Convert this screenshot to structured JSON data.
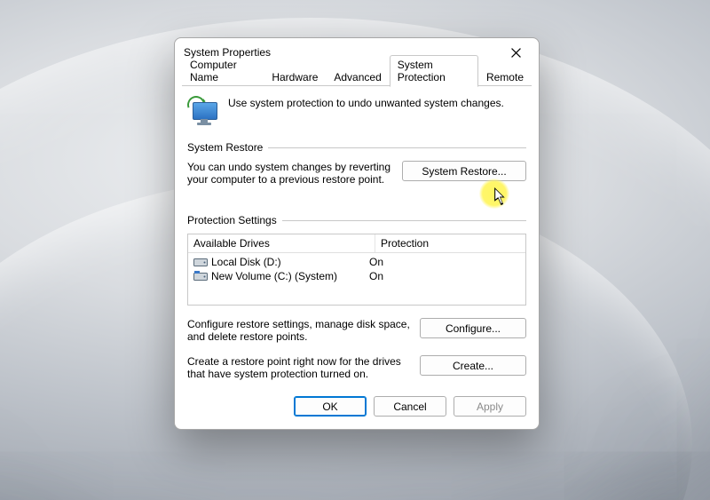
{
  "dialog": {
    "title": "System Properties"
  },
  "tabs": {
    "computer_name": "Computer Name",
    "hardware": "Hardware",
    "advanced": "Advanced",
    "system_protection": "System Protection",
    "remote": "Remote"
  },
  "intro": "Use system protection to undo unwanted system changes.",
  "restore_group": {
    "heading": "System Restore",
    "description": "You can undo system changes by reverting your computer to a previous restore point.",
    "button": "System Restore..."
  },
  "protection_group": {
    "heading": "Protection Settings",
    "col_drive": "Available Drives",
    "col_protection": "Protection",
    "drives": [
      {
        "name": "Local Disk (D:)",
        "protection": "On"
      },
      {
        "name": "New Volume (C:) (System)",
        "protection": "On"
      }
    ],
    "configure_text": "Configure restore settings, manage disk space, and delete restore points.",
    "configure_button": "Configure...",
    "create_text": "Create a restore point right now for the drives that have system protection turned on.",
    "create_button": "Create..."
  },
  "footer": {
    "ok": "OK",
    "cancel": "Cancel",
    "apply": "Apply"
  }
}
